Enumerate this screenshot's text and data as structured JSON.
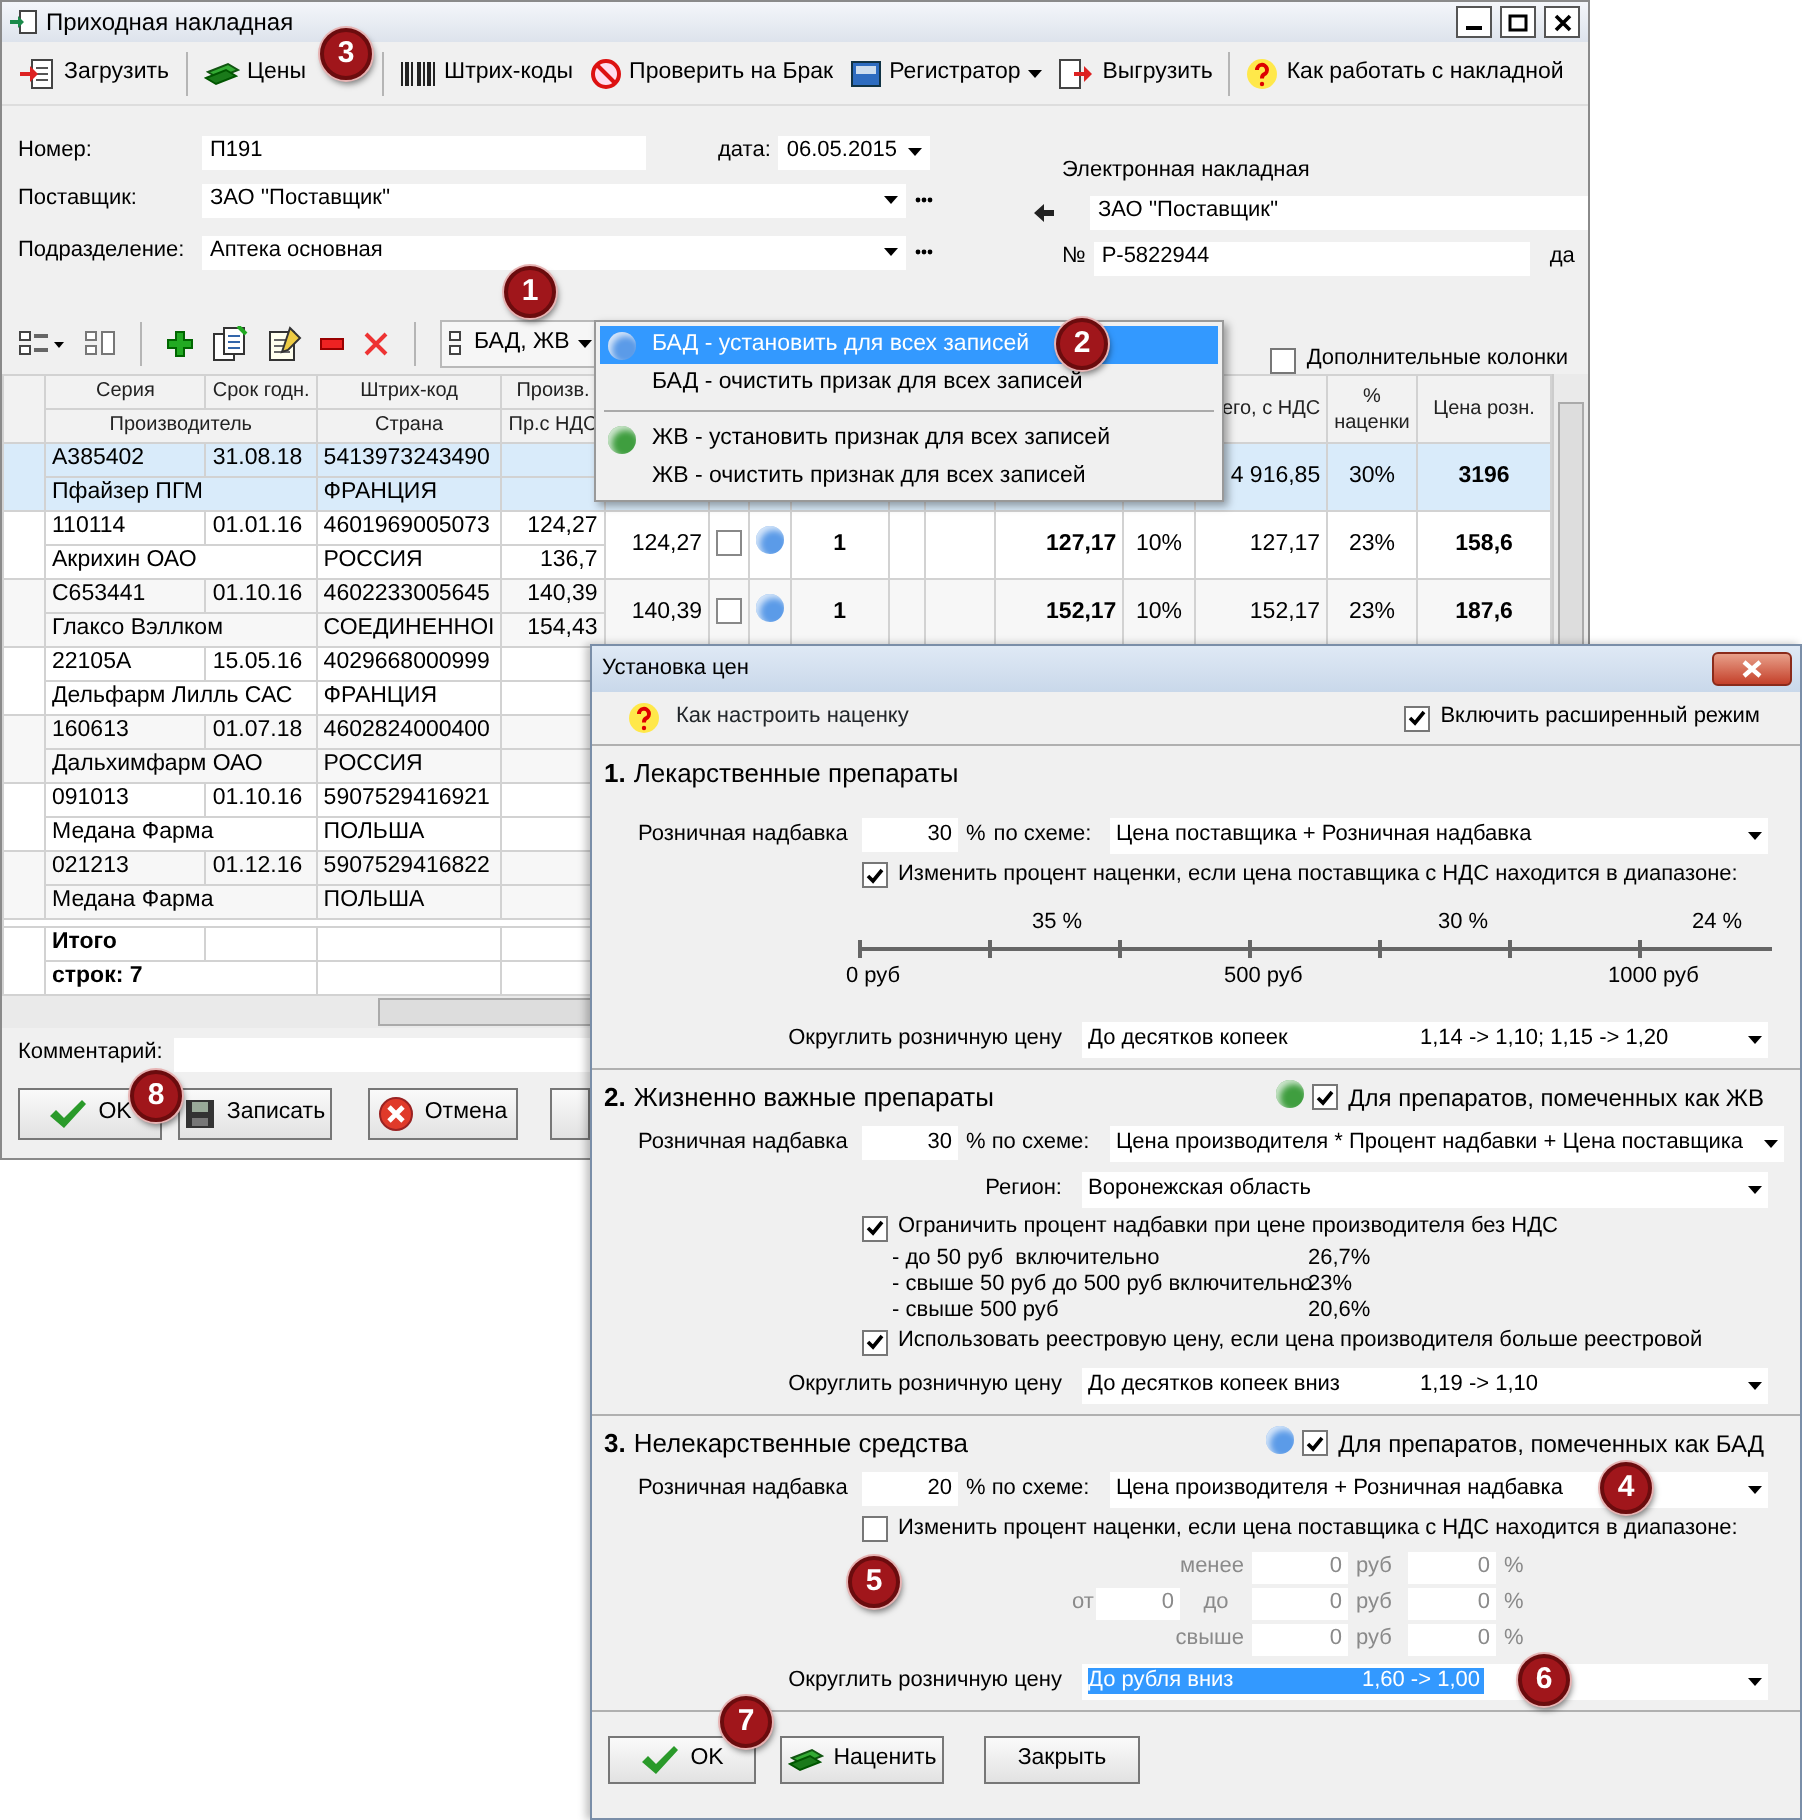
{
  "window": {
    "title": "Приходная накладная"
  },
  "toolbar": [
    {
      "label": "Загрузить",
      "kind": "load",
      "separator_after": true
    },
    {
      "label": "Цены",
      "kind": "money",
      "separator_after": true,
      "callout": "3"
    },
    {
      "label": "Штрих-коды",
      "kind": "barcode",
      "separator_after": false
    },
    {
      "label": "Проверить на Брак",
      "kind": "ban",
      "separator_after": false
    },
    {
      "label": "Регистратор",
      "kind": "device",
      "separator_after": false,
      "dropdown": true
    },
    {
      "label": "Выгрузить",
      "kind": "export",
      "separator_after": true
    },
    {
      "label": "Как работать с накладной",
      "kind": "help",
      "separator_after": false
    }
  ],
  "form": {
    "number_label": "Номер:",
    "number": "П191",
    "date_label": "дата:",
    "date": "06.05.2015",
    "supplier_label": "Поставщик:",
    "supplier": "ЗАО ''Поставщик''",
    "division_label": "Подразделение:",
    "division": "Аптека основная"
  },
  "electronic": {
    "title": "Электронная накладная",
    "supplier": "ЗАО ''Поставщик''",
    "number_label": "№",
    "number": "Р-5822944",
    "date_label": "да"
  },
  "grid_toolbar": {
    "flags_button": {
      "label": "БАД, ЖВ",
      "callout": "1"
    },
    "extra_columns": {
      "label": "Дополнительные колонки",
      "checked": false
    }
  },
  "menu": [
    {
      "label": "БАД - установить для всех записей",
      "color": "#5b9be8",
      "selected": true,
      "separator_before": false,
      "callout": "2"
    },
    {
      "label": "БАД - очистить призак для всех записей",
      "selected": false,
      "separator_before": false
    },
    {
      "label": "ЖВ - установить признак для всех записей",
      "color": "#3f9e3f",
      "selected": false,
      "separator_before": true
    },
    {
      "label": "ЖВ - очистить признак для всех записей",
      "selected": false,
      "separator_before": false
    }
  ],
  "table": {
    "columns_top": [
      "Серия",
      "Срок годн.",
      "Штрих-код",
      "Произв."
    ],
    "columns_bottom": [
      "Производитель",
      "Страна",
      "Пр.с НДС"
    ],
    "columns_right": {
      "total_vat": "его, с НДС",
      "markup": "% наценки",
      "retail": "Цена розн."
    },
    "rows": [
      {
        "series": "A385402",
        "expiry": "31.08.18",
        "barcode": "5413973243490",
        "maker": "Пфайзер ПГМ",
        "country": "ФРАНЦИЯ",
        "selected": true,
        "right": {
          "total_vat": "4 916,85",
          "markup": "30%",
          "retail": "3196"
        }
      },
      {
        "series": "110114",
        "expiry": "01.01.16",
        "barcode": "4601969005073",
        "price_maker": "124,27",
        "price_maker_vat": "136,7",
        "maker": "Акрихин ОАО",
        "country": "РОССИЯ",
        "selected": false,
        "right": {
          "price": "124,27",
          "flag_checked": false,
          "color": "#5b9be8",
          "qty": "1",
          "sum": "127,17",
          "vat": "10%",
          "total_vat": "127,17",
          "markup": "23%",
          "retail": "158,6"
        }
      },
      {
        "series": "C653441",
        "expiry": "01.10.16",
        "barcode": "4602233005645",
        "price_maker": "140,39",
        "price_maker_vat": "154,43",
        "maker": "Глаксо Вэллком",
        "country": "СОЕДИНЕННОІ",
        "selected": false,
        "right": {
          "price": "140,39",
          "flag_checked": false,
          "color": "#5b9be8",
          "qty": "1",
          "sum": "152,17",
          "vat": "10%",
          "total_vat": "152,17",
          "markup": "23%",
          "retail": "187,6"
        }
      },
      {
        "series": "22105A",
        "expiry": "15.05.16",
        "barcode": "4029668000999",
        "maker": "Дельфарм Лилль САС",
        "country": "ФРАНЦИЯ",
        "selected": false
      },
      {
        "series": "160613",
        "expiry": "01.07.18",
        "barcode": "4602824000400",
        "maker": "Дальхимфарм ОАО",
        "country": "РОССИЯ",
        "selected": false
      },
      {
        "series": "091013",
        "expiry": "01.10.16",
        "barcode": "5907529416921",
        "maker": "Медана Фарма",
        "country": "ПОЛЬША",
        "selected": false
      },
      {
        "series": "021213",
        "expiry": "01.12.16",
        "barcode": "5907529416822",
        "maker": "Медана Фарма",
        "country": "ПОЛЬША",
        "selected": false
      }
    ],
    "totals": {
      "label": "Итого",
      "count": "строк: 7"
    }
  },
  "comment_label": "Комментарий:",
  "buttons": [
    {
      "label": "OK",
      "kind": "ok",
      "callout": "8"
    },
    {
      "label": "Записать",
      "kind": "save"
    },
    {
      "label": "Отмена",
      "kind": "cancel"
    }
  ],
  "dialog": {
    "title": "Установка цен",
    "help_link": "Как настроить наценку",
    "advanced": {
      "label": "Включить расширенный режим",
      "checked": true
    },
    "sections": [
      {
        "kind": "range",
        "number": "1.",
        "title": "Лекарственные препараты",
        "markup_label": "Розничная надбавка",
        "markup": "30",
        "percent": "%",
        "scheme_label": "по схеме:",
        "scheme": "Цена поставщика + Розничная надбавка",
        "range_check": {
          "label": "Изменить процент наценки, если цена поставщика с НДС находится в диапазоне:",
          "checked": true
        },
        "scale": {
          "percents": [
            "35 %",
            "30 %",
            "24 %"
          ],
          "ticks": [
            "0 руб",
            "500 руб",
            "1000 руб"
          ]
        },
        "rounding_label": "Округлить розничную цену",
        "rounding": "До десятков копеек",
        "rounding_example": "1,14 -> 1,10;  1,15 -> 1,20",
        "rounding_selected": false
      },
      {
        "kind": "limits",
        "number": "2.",
        "title": "Жизненно важные препараты",
        "marker": {
          "color": "#3f9e3f",
          "label": "Для препаратов, помеченных как ЖВ",
          "checked": true
        },
        "markup_label": "Розничная надбавка",
        "markup": "30",
        "scheme_label": "% по схеме:",
        "scheme": "Цена производителя * Процент надбавки + Цена поставщика",
        "region_label": "Регион:",
        "region": "Воронежская область",
        "limit_check": {
          "label": "Ограничить процент надбавки при цене производителя без НДС",
          "checked": true
        },
        "limits": [
          {
            "label": "- до 50 руб  включительно",
            "value": "26,7%"
          },
          {
            "label": "- свыше 50 руб до 500 руб включительно",
            "value": "23%"
          },
          {
            "label": "- свыше 500 руб",
            "value": "20,6%"
          }
        ],
        "registry_check": {
          "label": "Использовать реестровую цену, если цена производителя больше реестровой",
          "checked": true
        },
        "rounding_label": "Округлить розничную цену",
        "rounding": "До десятков копеек вниз",
        "rounding_example": "1,19 -> 1,10",
        "rounding_selected": false
      },
      {
        "kind": "grid",
        "number": "3.",
        "title": "Нелекарственные средства",
        "marker": {
          "color": "#5b9be8",
          "label": "Для препаратов, помеченных как БАД",
          "checked": true
        },
        "markup_label": "Розничная надбавка",
        "markup": "20",
        "scheme_label": "% по схеме:",
        "scheme": "Цена производителя + Розничная надбавка",
        "scheme_callout": "4",
        "range_check": {
          "label": "Изменить процент наценки, если цена поставщика с НДС находится в диапазоне:",
          "checked": false
        },
        "range_callout": "5",
        "range_rows": [
          {
            "label": "менее",
            "value": "0",
            "unit": "руб",
            "percent": "0",
            "percent_sign": "%"
          },
          {
            "from_label": "от",
            "from": "0",
            "label": "до",
            "value": "0",
            "unit": "руб",
            "percent": "0",
            "percent_sign": "%"
          },
          {
            "label": "свыше",
            "value": "0",
            "unit": "руб",
            "percent": "0",
            "percent_sign": "%"
          }
        ],
        "rounding_label": "Округлить розничную цену",
        "rounding": "До рубля вниз",
        "rounding_example": "1,60 -> 1,00",
        "rounding_selected": true,
        "rounding_callout": "6"
      }
    ],
    "buttons": [
      {
        "label": "OK",
        "kind": "ok",
        "callout": "7"
      },
      {
        "label": "Наценить",
        "kind": "money"
      },
      {
        "label": "Закрыть",
        "kind": "plain"
      }
    ]
  }
}
